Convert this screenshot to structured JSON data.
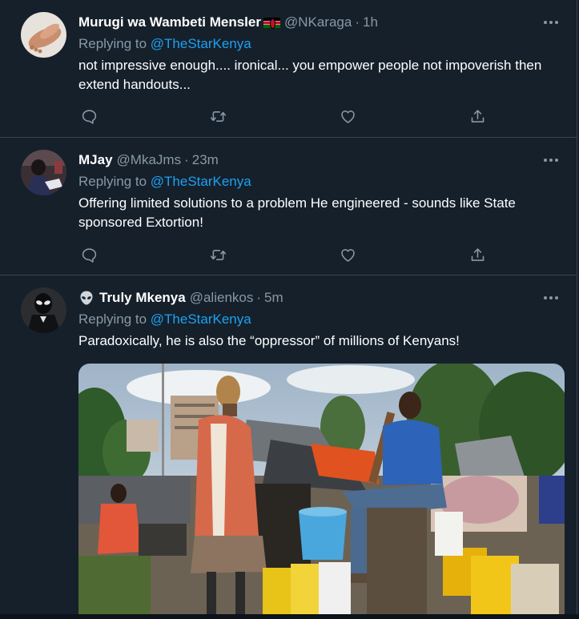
{
  "tweets": [
    {
      "name": "Murugi wa Wambeti Mensler",
      "flag": "kenya-flag",
      "handle": "@NKaraga",
      "sep": "·",
      "time": "1h",
      "replying_prefix": "Replying to ",
      "replying_to": "@TheStarKenya",
      "text": "not impressive enough.... ironical... you empower people not impoverish then extend handouts..."
    },
    {
      "name": "MJay",
      "handle": "@MkaJms",
      "sep": "·",
      "time": "23m",
      "replying_prefix": "Replying to ",
      "replying_to": "@TheStarKenya",
      "text": "Offering limited solutions to a problem He engineered - sounds like State sponsored Extortion!"
    },
    {
      "name": "Truly Mkenya",
      "name_icon": "alien-icon",
      "handle": "@alienkos",
      "sep": "·",
      "time": "5m",
      "replying_prefix": "Replying to ",
      "replying_to": "@TheStarKenya",
      "text": "Paradoxically, he is also the “oppressor” of millions of Kenyans!"
    }
  ],
  "colors": {
    "background": "#15202b",
    "border": "#38444d",
    "secondary_text": "#8899a6",
    "accent": "#1da1f2"
  },
  "icons": [
    "reply-icon",
    "retweet-icon",
    "like-icon",
    "share-icon",
    "more-icon"
  ]
}
